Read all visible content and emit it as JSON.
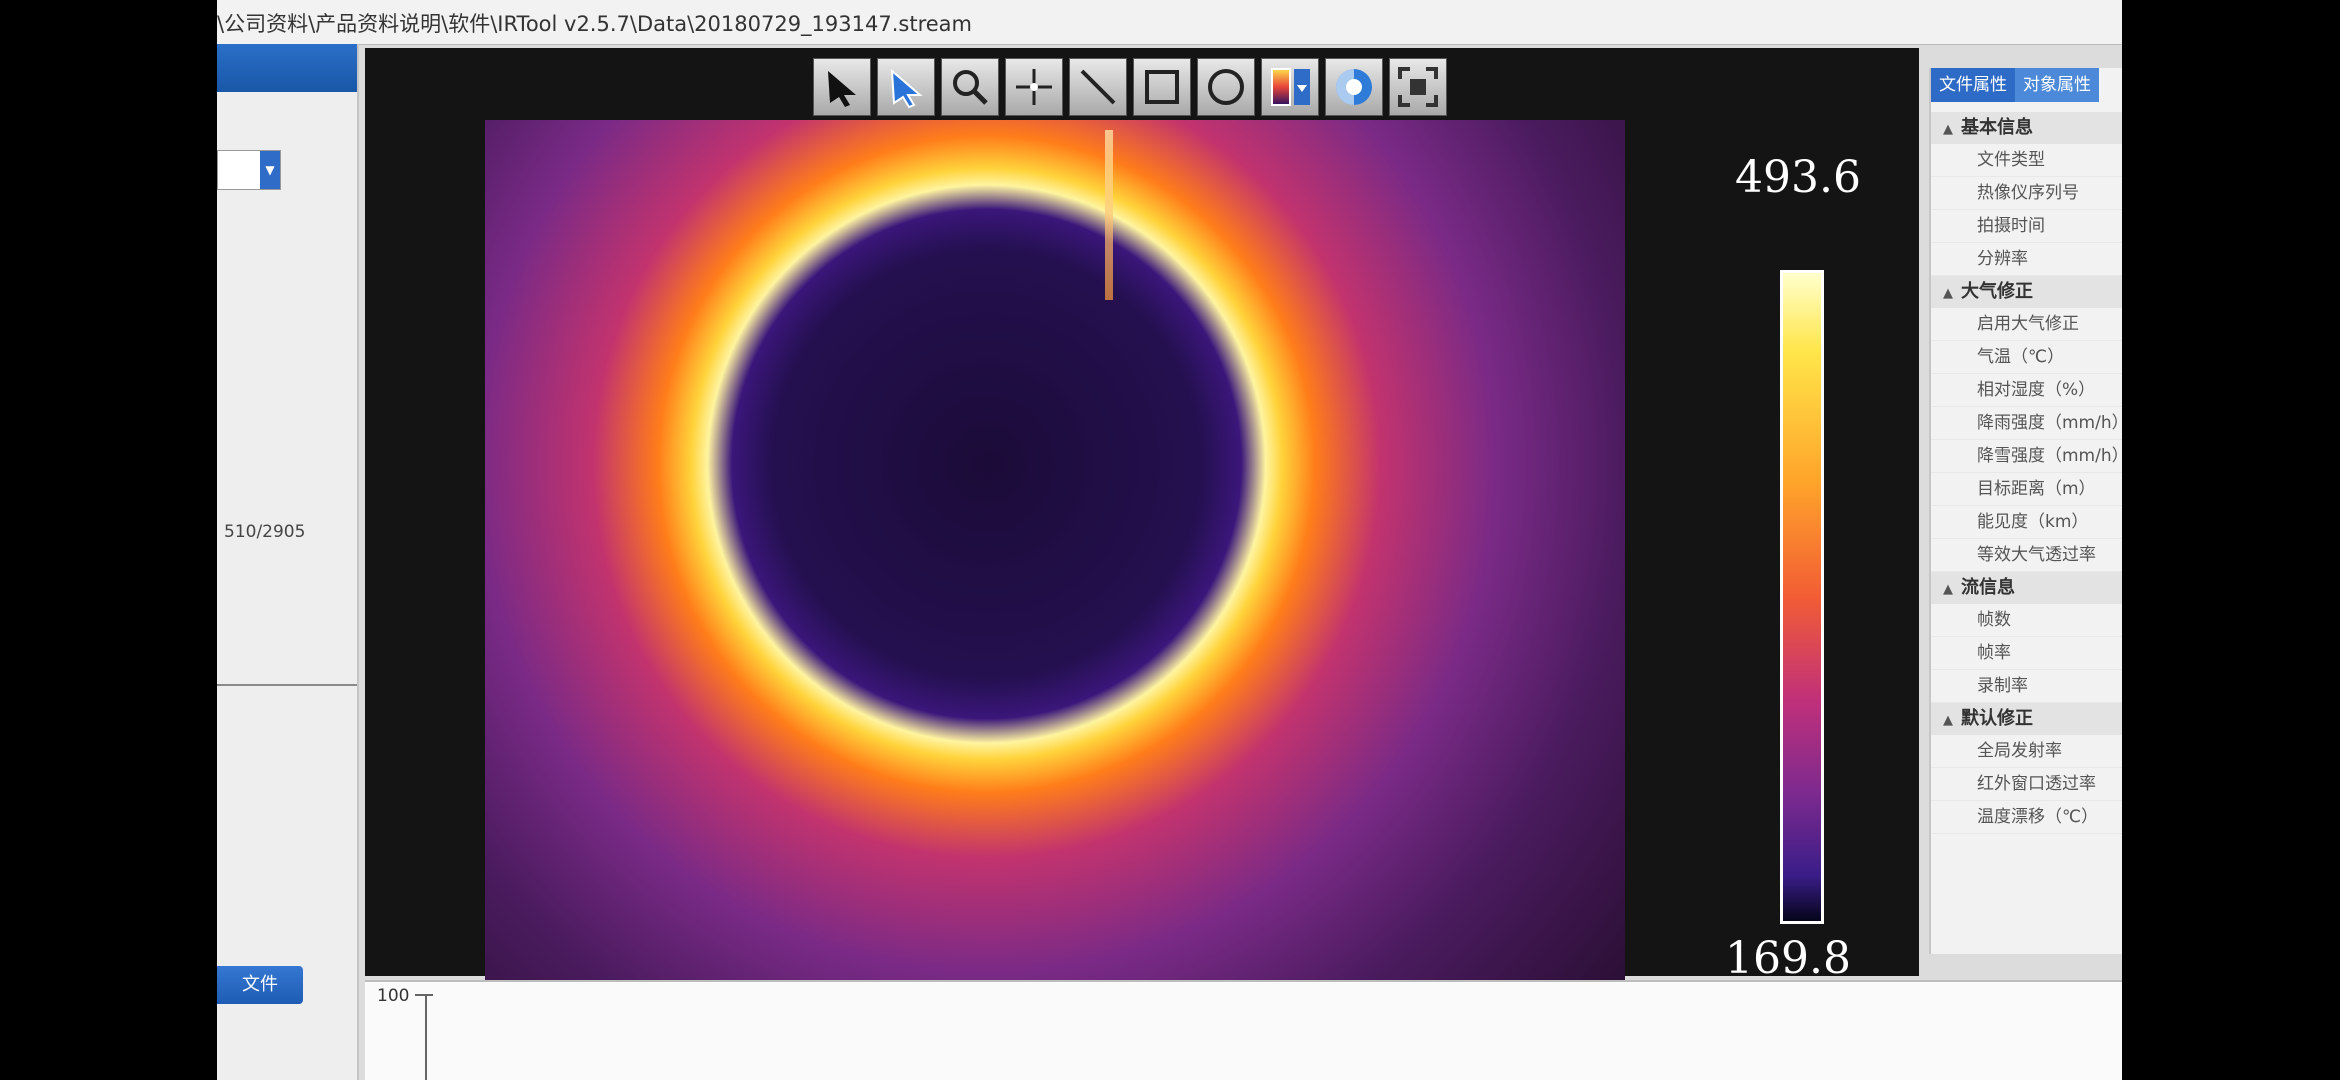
{
  "window": {
    "title": "\\公司资料\\产品资料说明\\软件\\IRTool v2.5.7\\Data\\20180729_193147.stream"
  },
  "left_panel": {
    "frame_counter": "510/2905",
    "open_file_button": "文件"
  },
  "toolbar": {
    "tools": [
      {
        "name": "select-arrow-icon"
      },
      {
        "name": "pointer-arrow-icon"
      },
      {
        "name": "zoom-icon"
      },
      {
        "name": "point-measure-icon"
      },
      {
        "name": "line-measure-icon"
      },
      {
        "name": "rectangle-measure-icon"
      },
      {
        "name": "circle-measure-icon"
      },
      {
        "name": "palette-dropdown-icon"
      },
      {
        "name": "temperature-icon"
      },
      {
        "name": "fit-screen-icon"
      }
    ]
  },
  "thermal": {
    "max_temp": "493.6",
    "min_temp": "169.8"
  },
  "right_panel": {
    "tabs": [
      "文件属性",
      "对象属性"
    ],
    "groups": [
      {
        "title": "基本信息",
        "items": [
          "文件类型",
          "热像仪序列号",
          "拍摄时间",
          "分辨率"
        ]
      },
      {
        "title": "大气修正",
        "items": [
          "启用大气修正",
          "气温（℃）",
          "相对湿度（%）",
          "降雨强度（mm/h）",
          "降雪强度（mm/h）",
          "目标距离（m）",
          "能见度（km）",
          "等效大气透过率"
        ]
      },
      {
        "title": "流信息",
        "items": [
          "帧数",
          "帧率",
          "录制率"
        ]
      },
      {
        "title": "默认修正",
        "items": [
          "全局发射率",
          "红外窗口透过率",
          "温度漂移（℃）"
        ]
      }
    ]
  },
  "graph": {
    "y_tick_top": "100"
  }
}
